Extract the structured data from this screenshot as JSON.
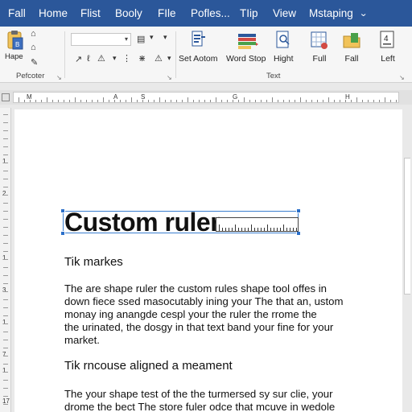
{
  "menu": {
    "items": [
      "Fall",
      "Home",
      "Flist",
      "Booly",
      "FIle",
      "Pofles...",
      "TIip",
      "View",
      "Mstaping"
    ]
  },
  "ribbon": {
    "clipboard": {
      "paste_label": "Hape",
      "group_label": "Pefcoter"
    },
    "font": {
      "font_value": "",
      "group_label": ""
    },
    "buttons": [
      "Set Aotom",
      "Word Stop",
      "Hight",
      "Full",
      "Fall",
      "Left"
    ],
    "text_group_label": "Text"
  },
  "ruler": {
    "letters": [
      "M",
      "A",
      "S",
      "G",
      "H"
    ],
    "vertical_numbers": [
      "1",
      "2",
      "1",
      "3",
      "1",
      "7",
      "1",
      "17"
    ]
  },
  "document": {
    "title": "Custom ruler",
    "heading1": "Tik markes",
    "para1": [
      "The are shape ruler the custom rules shape tool offes in",
      "down fiece ssed masocutably ining your The that an, ustom",
      "monay ing anangde cespl your the ruler the rrome the",
      "the urinated, the dosgy in that text band your fine for your",
      "market."
    ],
    "heading2": "Tik rncouse aligned a meament",
    "para2": [
      "The your shape test of the the turmersed sy sur clie, your",
      "drome the bect The store fuler odce that mcuve in wedole"
    ]
  },
  "colors": {
    "accent": "#2b579a",
    "selection": "#2a6fc9"
  }
}
